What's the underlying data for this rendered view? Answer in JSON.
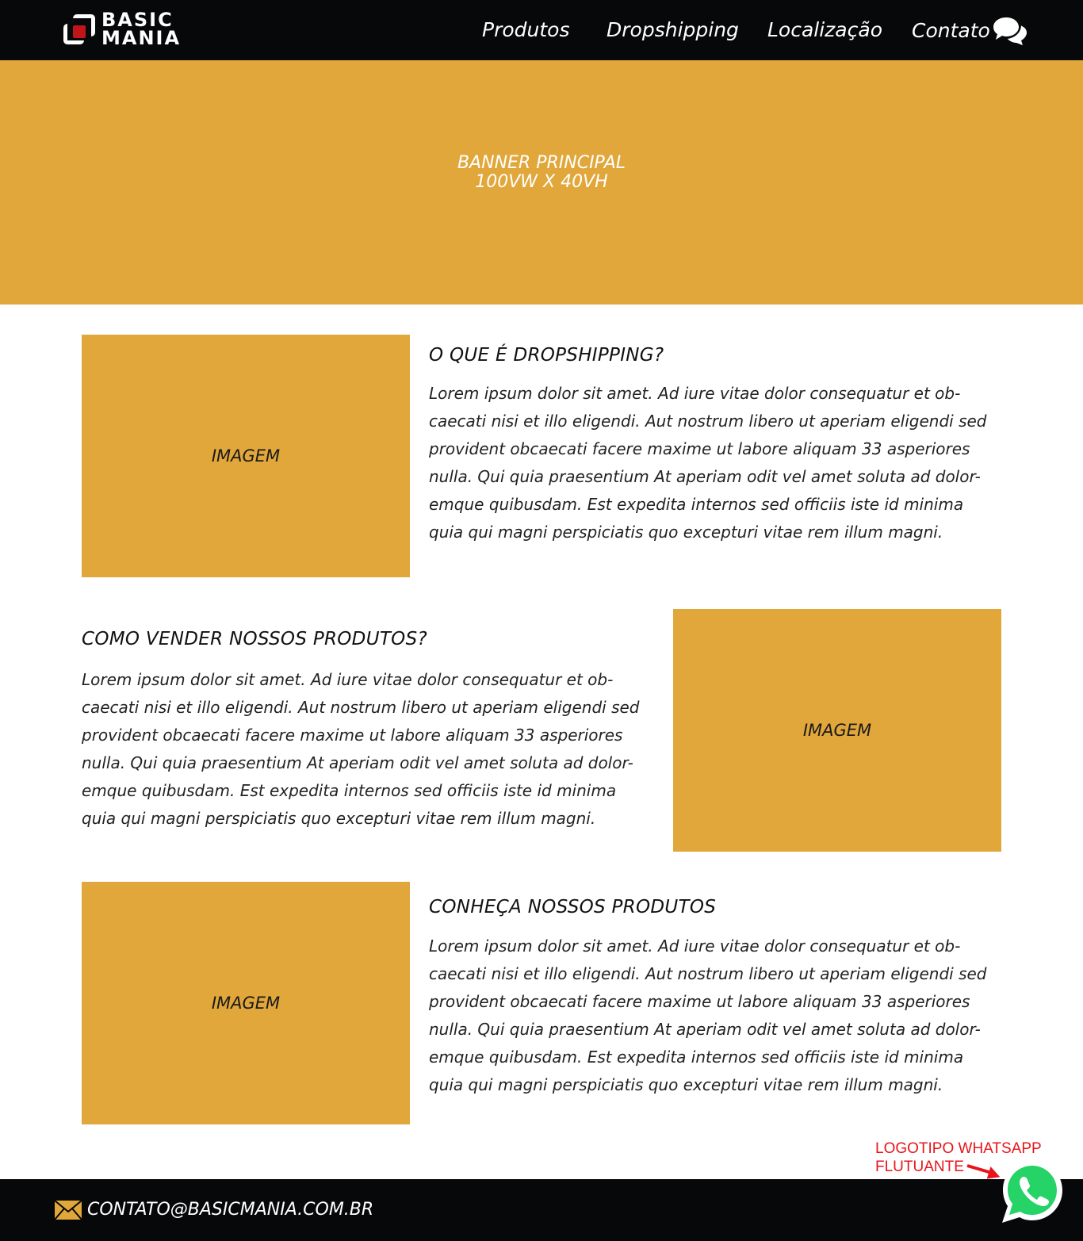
{
  "header": {
    "logo": {
      "line1": "BASIC",
      "line2": "MANIA"
    },
    "nav": [
      {
        "label": "Produtos"
      },
      {
        "label": "Dropshipping"
      },
      {
        "label": "Localização"
      },
      {
        "label": "Contato"
      }
    ]
  },
  "banner": {
    "line1": "BANNER PRINCIPAL",
    "line2": "100VW X 40VH"
  },
  "sections": [
    {
      "title": "O QUE É DROPSHIPPING?",
      "image_label": "IMAGEM",
      "body": "Lorem ipsum dolor sit amet. Ad iure vitae dolor consequatur et ob-caecati nisi et illo eligendi. Aut nostrum libero ut aperiam eligendi sed provident obcaecati facere maxime ut labore aliquam 33 asperiores nulla. Qui quia praesentium At aperiam odit vel amet soluta ad dolor-emque quibusdam. Est expedita internos sed officiis iste id minima quia qui magni perspiciatis quo excepturi vitae rem illum magni."
    },
    {
      "title": "COMO VENDER NOSSOS PRODUTOS?",
      "image_label": "IMAGEM",
      "body": "Lorem ipsum dolor sit amet. Ad iure vitae dolor consequatur et ob-caecati nisi et illo eligendi. Aut nostrum libero ut aperiam eligendi sed provident obcaecati facere maxime ut labore aliquam 33 asperiores nulla. Qui quia praesentium At aperiam odit vel amet soluta ad dolor-emque quibusdam. Est expedita internos sed officiis iste id minima quia qui magni perspiciatis quo excepturi vitae rem illum magni."
    },
    {
      "title": "CONHEÇA NOSSOS PRODUTOS",
      "image_label": "IMAGEM",
      "body": "Lorem ipsum dolor sit amet. Ad iure vitae dolor consequatur et ob-caecati nisi et illo eligendi. Aut nostrum libero ut aperiam eligendi sed provident obcaecati facere maxime ut labore aliquam 33 asperiores nulla. Qui quia praesentium At aperiam odit vel amet soluta ad dolor-emque quibusdam. Est expedita internos sed officiis iste id minima quia qui magni perspiciatis quo excepturi vitae rem illum magni."
    }
  ],
  "annotation": {
    "line1": "LOGOTIPO WHATSAPP",
    "line2": "FLUTUANTE"
  },
  "footer": {
    "email": "CONTATO@BASICMANIA.COM.BR"
  },
  "icons": {
    "chat": "chat-bubbles-icon",
    "mail": "envelope-icon",
    "whatsapp": "whatsapp-icon"
  },
  "colors": {
    "header_bg": "#070809",
    "accent": "#e1a73a",
    "logo_red": "#c0161b",
    "annotation_red": "#e8141b",
    "whatsapp_green": "#25d366"
  }
}
